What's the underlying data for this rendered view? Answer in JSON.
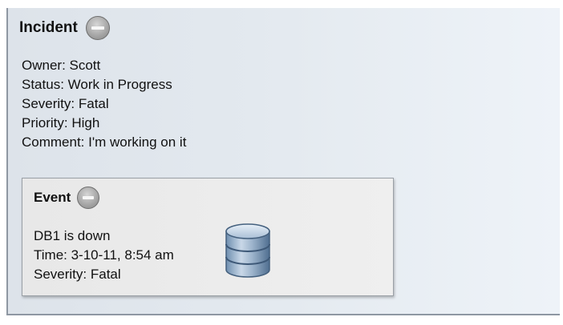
{
  "incident": {
    "title": "Incident",
    "details": [
      "Owner: Scott",
      "Status: Work in Progress",
      "Severity: Fatal",
      "Priority: High",
      "Comment: I'm working on it"
    ]
  },
  "event": {
    "title": "Event",
    "details": [
      "DB1 is down",
      "Time: 3-10-11, 8:54 am",
      "Severity: Fatal"
    ]
  },
  "icons": {
    "collapse": "minus-circle-icon",
    "database": "database-icon"
  }
}
